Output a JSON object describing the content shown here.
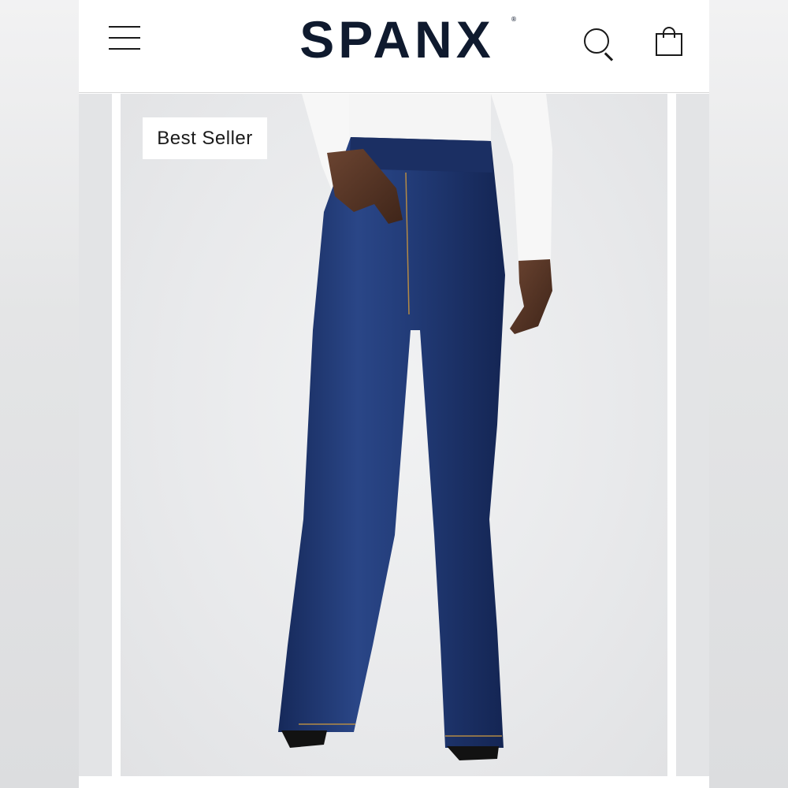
{
  "header": {
    "brand": "SPANX",
    "brand_mark": "®",
    "menu_icon": "hamburger-menu-icon",
    "search_icon": "search-icon",
    "cart_icon": "shopping-bag-icon"
  },
  "product": {
    "badge": "Best Seller",
    "image_subject": "flare jeans",
    "denim_color": "#1f3670",
    "top_color": "#f7f7f7"
  },
  "colors": {
    "brand": "#0f1a2e",
    "header_bg": "#ffffff",
    "image_bg": "#e8e9eb"
  }
}
